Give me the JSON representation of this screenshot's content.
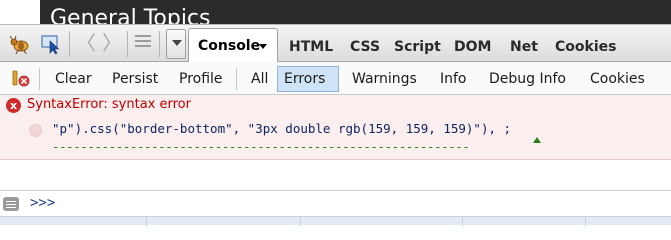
{
  "page": {
    "heading": "General Topics"
  },
  "toolbar": {
    "icons": [
      "firebug-icon",
      "inspect-icon",
      "back-icon",
      "forward-icon",
      "console-list-icon",
      "dropdown-icon"
    ],
    "back_glyph": "〈",
    "forward_glyph": "〉",
    "active_tab": "Console",
    "tabs": [
      "HTML",
      "CSS",
      "Script",
      "DOM",
      "Net",
      "Cookies"
    ]
  },
  "filterbar": {
    "actions": [
      "Clear",
      "Persist",
      "Profile"
    ],
    "filters": [
      "All",
      "Errors",
      "Warnings",
      "Info",
      "Debug Info",
      "Cookies"
    ],
    "selected_filter": "Errors"
  },
  "console": {
    "error": {
      "icon": "x",
      "message": "SyntaxError: syntax error",
      "code": "\"p\").css(\"border-bottom\", \"3px double rgb(159, 159, 159)\"), ;",
      "pointer": "-----------------------------------------------------------"
    },
    "prompt": ">>>"
  },
  "colors": {
    "error_text": "#c00000",
    "error_background": "#fbeeee",
    "selected_filter_background": "#cfe3f7",
    "prompt_text": "#1e3c8a"
  }
}
